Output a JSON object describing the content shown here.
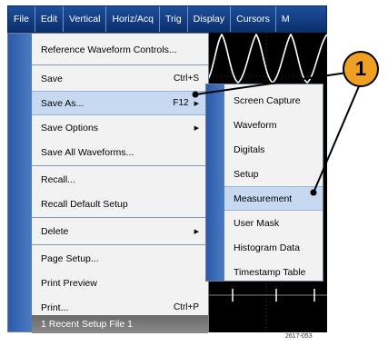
{
  "menubar": {
    "items": [
      "File",
      "Edit",
      "Vertical",
      "Horiz/Acq",
      "Trig",
      "Display",
      "Cursors",
      "M"
    ]
  },
  "file_menu": {
    "items": [
      {
        "label": "Reference Waveform Controls...",
        "shortcut": "",
        "submenu": false
      },
      {
        "label": "Save",
        "shortcut": "Ctrl+S",
        "submenu": false
      },
      {
        "label": "Save As...",
        "shortcut": "F12",
        "submenu": true
      },
      {
        "label": "Save Options",
        "shortcut": "",
        "submenu": true
      },
      {
        "label": "Save All Waveforms...",
        "shortcut": "",
        "submenu": false
      },
      {
        "label": "Recall...",
        "shortcut": "",
        "submenu": false
      },
      {
        "label": "Recall Default Setup",
        "shortcut": "",
        "submenu": false
      },
      {
        "label": "Delete",
        "shortcut": "",
        "submenu": true
      },
      {
        "label": "Page Setup...",
        "shortcut": "",
        "submenu": false
      },
      {
        "label": "Print Preview",
        "shortcut": "",
        "submenu": false
      },
      {
        "label": "Print...",
        "shortcut": "Ctrl+P",
        "submenu": false
      },
      {
        "label": "1 Recent Setup File 1",
        "shortcut": "",
        "submenu": false
      }
    ]
  },
  "save_as_submenu": {
    "items": [
      "Screen Capture",
      "Waveform",
      "Digitals",
      "Setup",
      "Measurement",
      "User Mask",
      "Histogram Data",
      "Timestamp Table"
    ]
  },
  "callout": {
    "number": "1"
  },
  "figure_number": "2617-053",
  "colors": {
    "menubar": "#1f4e9c",
    "highlight": "#c6d9f1",
    "callout": "#f0a020",
    "stripe": "#2b5aa8"
  }
}
